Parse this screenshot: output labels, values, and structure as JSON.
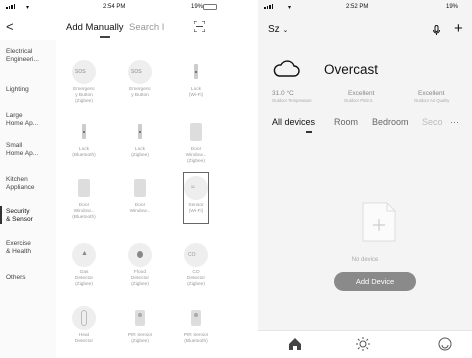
{
  "left": {
    "status": {
      "time": "2:54 PM",
      "battery": "19%"
    },
    "header": {
      "back": "<",
      "tab_add": "Add Manually",
      "tab_search": "Search I"
    },
    "sidebar": [
      "Electrical\nEngineeri...",
      "Lighting",
      "Large\nHome Ap...",
      "Small\nHome Ap...",
      "Kitchen\nAppliance",
      "Security\n& Sensor",
      "Exercise\n& Health",
      "Others"
    ],
    "sidebar_active_index": 5,
    "devices": [
      {
        "icon": "sos-button-icon",
        "icon_text": "SOS",
        "label": "Emergenc\ny Button\n(Zigbee)"
      },
      {
        "icon": "sos-button-icon",
        "icon_text": "SOS",
        "label": "Emergenc\ny Button"
      },
      {
        "icon": "lock-icon",
        "label": "Lock\n(Wi-Fi)"
      },
      {
        "icon": "lock-icon",
        "label": "Lock\n(Bluetooth)"
      },
      {
        "icon": "lock-icon",
        "label": "Lock\n(Zigbee)"
      },
      {
        "icon": "door-sensor-icon",
        "label": "Door\nWindow...\n(Zigbee)"
      },
      {
        "icon": "door-sensor-icon",
        "label": "Door\nWindow...\n(Bluetooth)"
      },
      {
        "icon": "door-sensor-icon",
        "label": "Door\nWindow..."
      },
      {
        "icon": "sensor-wave-icon",
        "label": "Sensor\n(Wi-Fi)"
      },
      {
        "icon": "flame-icon",
        "label": "Gas\nDetector\n(Zigbee)"
      },
      {
        "icon": "water-drop-icon",
        "label": "Flood\nDetector\n(Zigbee)"
      },
      {
        "icon": "co2-icon",
        "icon_text": "CO",
        "label": "CO\nDetector\n(Zigbee)"
      },
      {
        "icon": "thermometer-icon",
        "label": "Heat\nDetector"
      },
      {
        "icon": "pir-sensor-icon",
        "label": "PIR Sensor\n(Zigbee)"
      },
      {
        "icon": "pir-sensor-icon",
        "label": "PIR Sensor\n(Bluetooth)"
      }
    ]
  },
  "right": {
    "status": {
      "time": "2:52 PM",
      "battery": "19%"
    },
    "home": "Sz",
    "weather": {
      "condition": "Overcast",
      "stats": [
        {
          "value": "31.0 °C",
          "caption": "Outdoor Temperature"
        },
        {
          "value": "Excellent",
          "caption": "Outdoor PM2.5"
        },
        {
          "value": "Excellent",
          "caption": "Outdoor Air Quality"
        }
      ]
    },
    "tabs": [
      "All devices",
      "Room",
      "Bedroom",
      "Seco"
    ],
    "empty_text": "No device",
    "add_button": "Add Device",
    "more": "···",
    "nav": [
      {
        "icon": "home-icon",
        "label": ""
      },
      {
        "icon": "sun-icon",
        "label": ""
      },
      {
        "icon": "profile-icon",
        "label": ""
      }
    ]
  }
}
